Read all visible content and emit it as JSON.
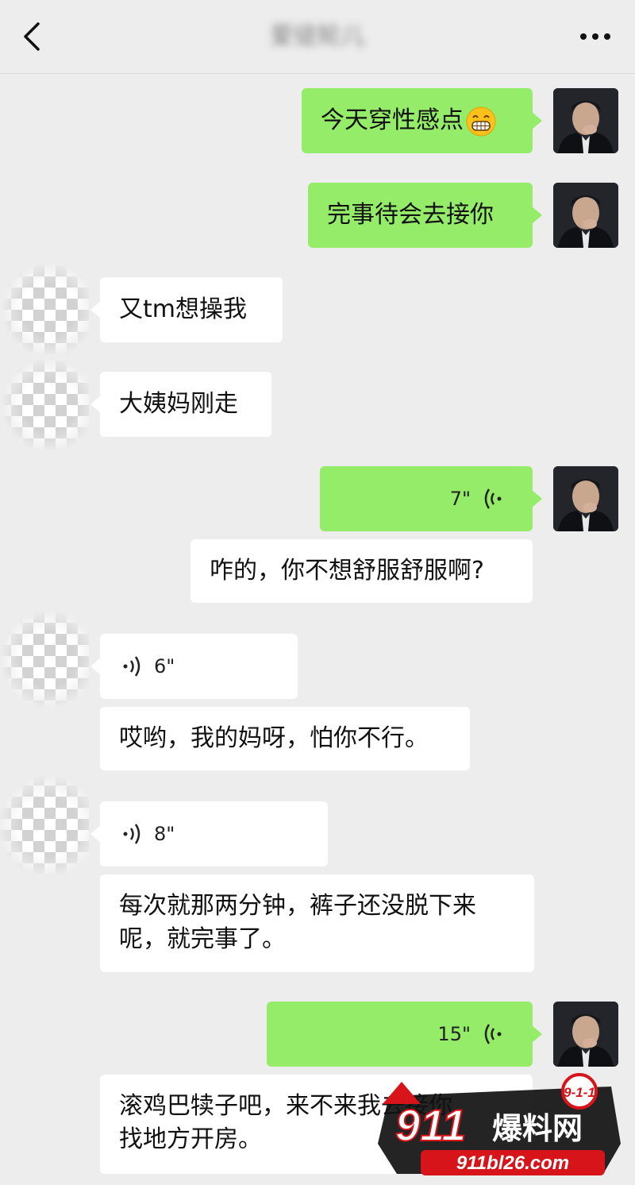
{
  "header": {
    "title": "爱徒轮儿",
    "back_icon": "chevron-left-icon",
    "more_icon": "more-dots-icon"
  },
  "messages": [
    {
      "from": "me",
      "type": "text",
      "text": "今天穿性感点",
      "emoji": "grinning-face-emoji"
    },
    {
      "from": "me",
      "type": "text",
      "text": "完事待会去接你"
    },
    {
      "from": "other",
      "type": "text",
      "text": "又tm想操我"
    },
    {
      "from": "other",
      "type": "text",
      "text": "大姨妈刚走"
    },
    {
      "from": "me",
      "type": "voice",
      "duration": "7\"",
      "transcript": "咋的，你不想舒服舒服啊?"
    },
    {
      "from": "other",
      "type": "voice",
      "duration": "6\"",
      "transcript": "哎哟，我的妈呀，怕你不行。"
    },
    {
      "from": "other",
      "type": "voice",
      "duration": "8\"",
      "transcript_line1": "每次就那两分钟，裤子还没脱下来",
      "transcript_line2": "呢，就完事了。"
    },
    {
      "from": "me",
      "type": "voice",
      "duration": "15\"",
      "transcript_line1": "滚鸡巴犊子吧，来不来我去接你",
      "transcript_line2": "找地方开房。"
    }
  ],
  "watermark": {
    "badge": "9-1-1",
    "brand_number": "911",
    "brand_text": "爆料网",
    "url": "911bl26.com"
  },
  "colors": {
    "background": "#ededed",
    "sent_bubble": "#95ec69",
    "received_bubble": "#ffffff",
    "watermark_red": "#d7141a"
  }
}
